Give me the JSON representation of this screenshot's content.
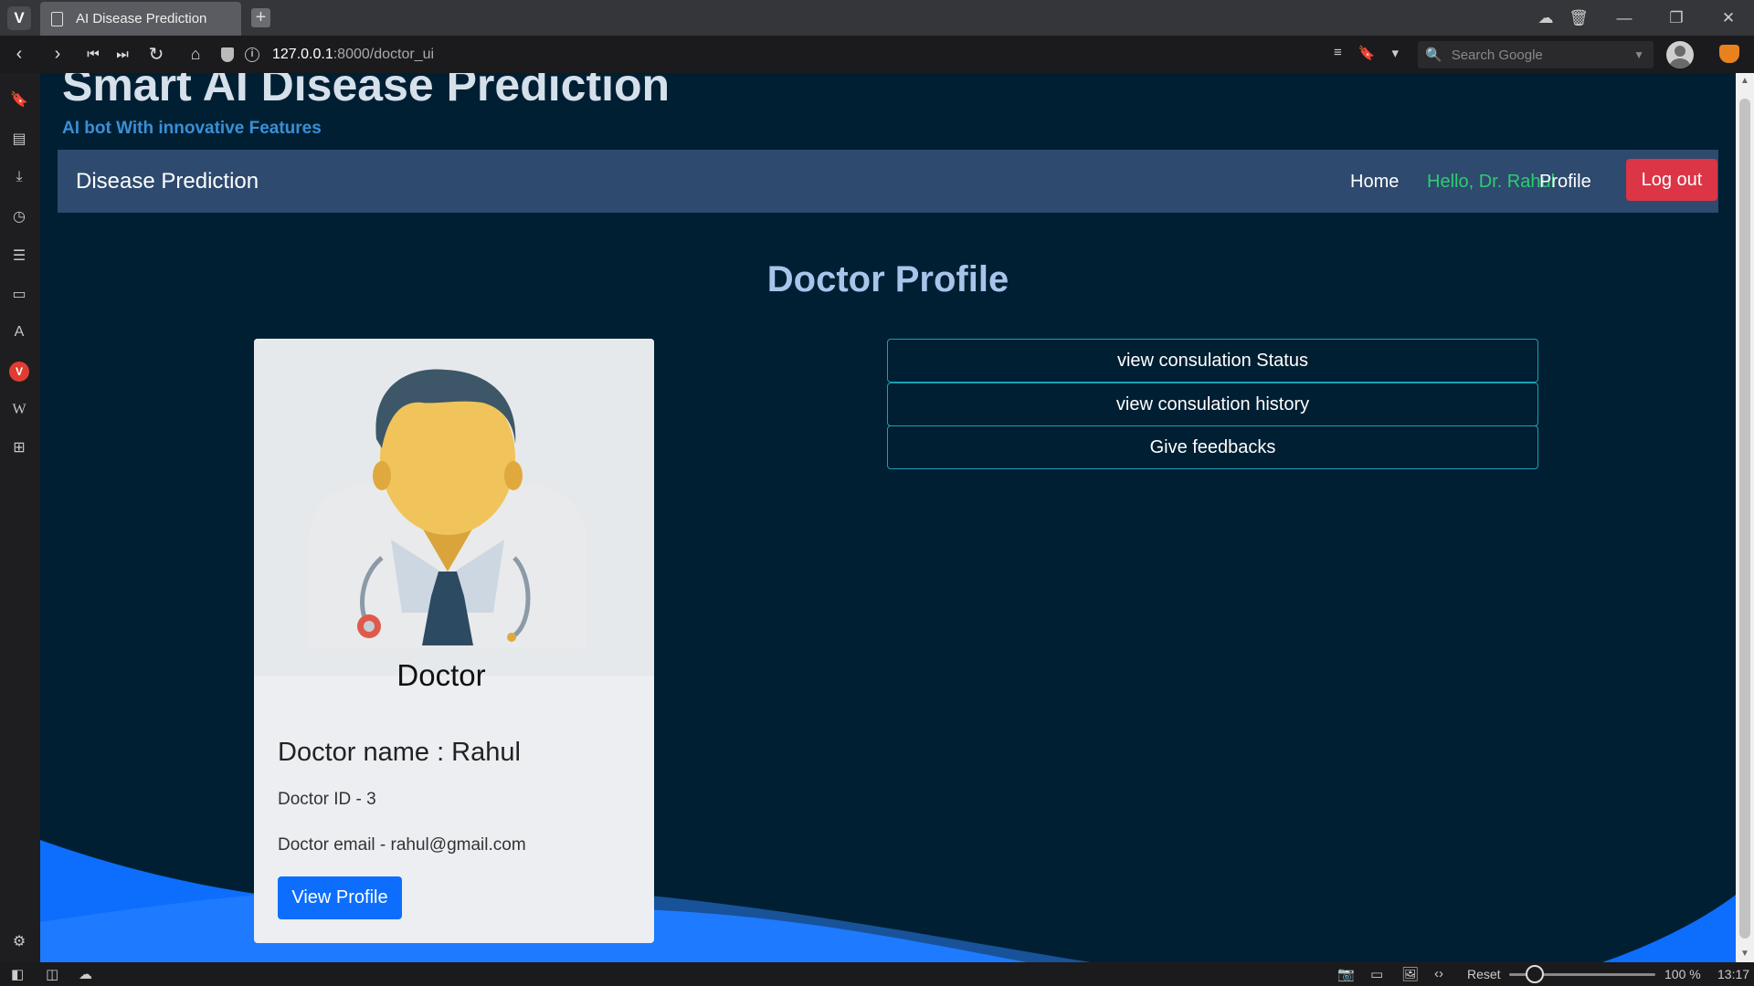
{
  "browser": {
    "tab_title": "AI Disease Prediction",
    "url_host": "127.0.0.1",
    "url_path": ":8000/doctor_ui",
    "search_placeholder": "Search Google",
    "zoom_reset": "Reset",
    "zoom_level": "100 %",
    "clock": "13:17"
  },
  "site": {
    "title": "Smart AI Disease Prediction",
    "subtitle": "AI bot With innovative Features"
  },
  "navbar": {
    "brand": "Disease Prediction",
    "home": "Home",
    "greeting": "Hello, Dr. Rahul",
    "profile": "Profile",
    "logout": "Log out"
  },
  "page": {
    "heading": "Doctor Profile"
  },
  "card": {
    "image_label": "Doctor",
    "name": "Doctor name : Rahul",
    "id": "Doctor ID - 3",
    "email": "Doctor email - rahul@gmail.com",
    "button": "View Profile"
  },
  "actions": [
    {
      "label": "view consulation Status"
    },
    {
      "label": "view consulation history"
    },
    {
      "label": "Give feedbacks"
    }
  ],
  "colors": {
    "page_bg": "#001f33",
    "navbar_bg": "#2e4a6e",
    "logout": "#dc3545",
    "primary": "#0d6efd",
    "greeting": "#2ecc71",
    "heading": "#a9c4ea",
    "action_border": "#17a2b8"
  }
}
